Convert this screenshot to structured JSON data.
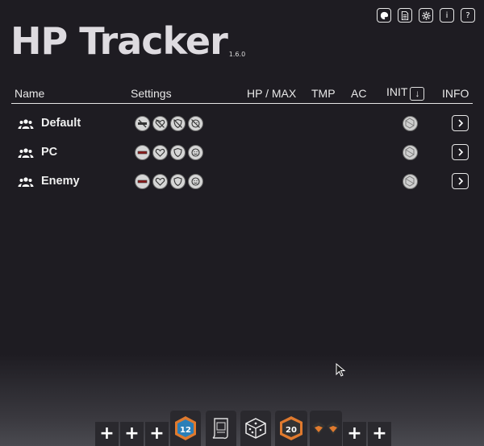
{
  "app": {
    "title": "HP Tracker",
    "version": "1.6.0"
  },
  "top_buttons": [
    {
      "name": "palette-icon"
    },
    {
      "name": "document-icon"
    },
    {
      "name": "gear-icon"
    },
    {
      "name": "info-icon",
      "label": "i"
    },
    {
      "name": "help-icon",
      "label": "?"
    }
  ],
  "table": {
    "headers": {
      "name": "Name",
      "settings": "Settings",
      "hp_max": "HP / MAX",
      "tmp": "TMP",
      "ac": "AC",
      "init": "INIT",
      "info": "INFO"
    },
    "init_sort_glyph": "↓"
  },
  "groups": [
    {
      "name": "Default",
      "settings_disabled": true
    },
    {
      "name": "PC",
      "settings_disabled": false
    },
    {
      "name": "Enemy",
      "settings_disabled": false
    }
  ],
  "toolbar": {
    "plus_label": "+",
    "d20_left_value": "12",
    "d20_right_value": "20"
  },
  "colors": {
    "background": "#1e1c22",
    "title": "#dedbe0",
    "accent_orange": "#e07a2e"
  }
}
